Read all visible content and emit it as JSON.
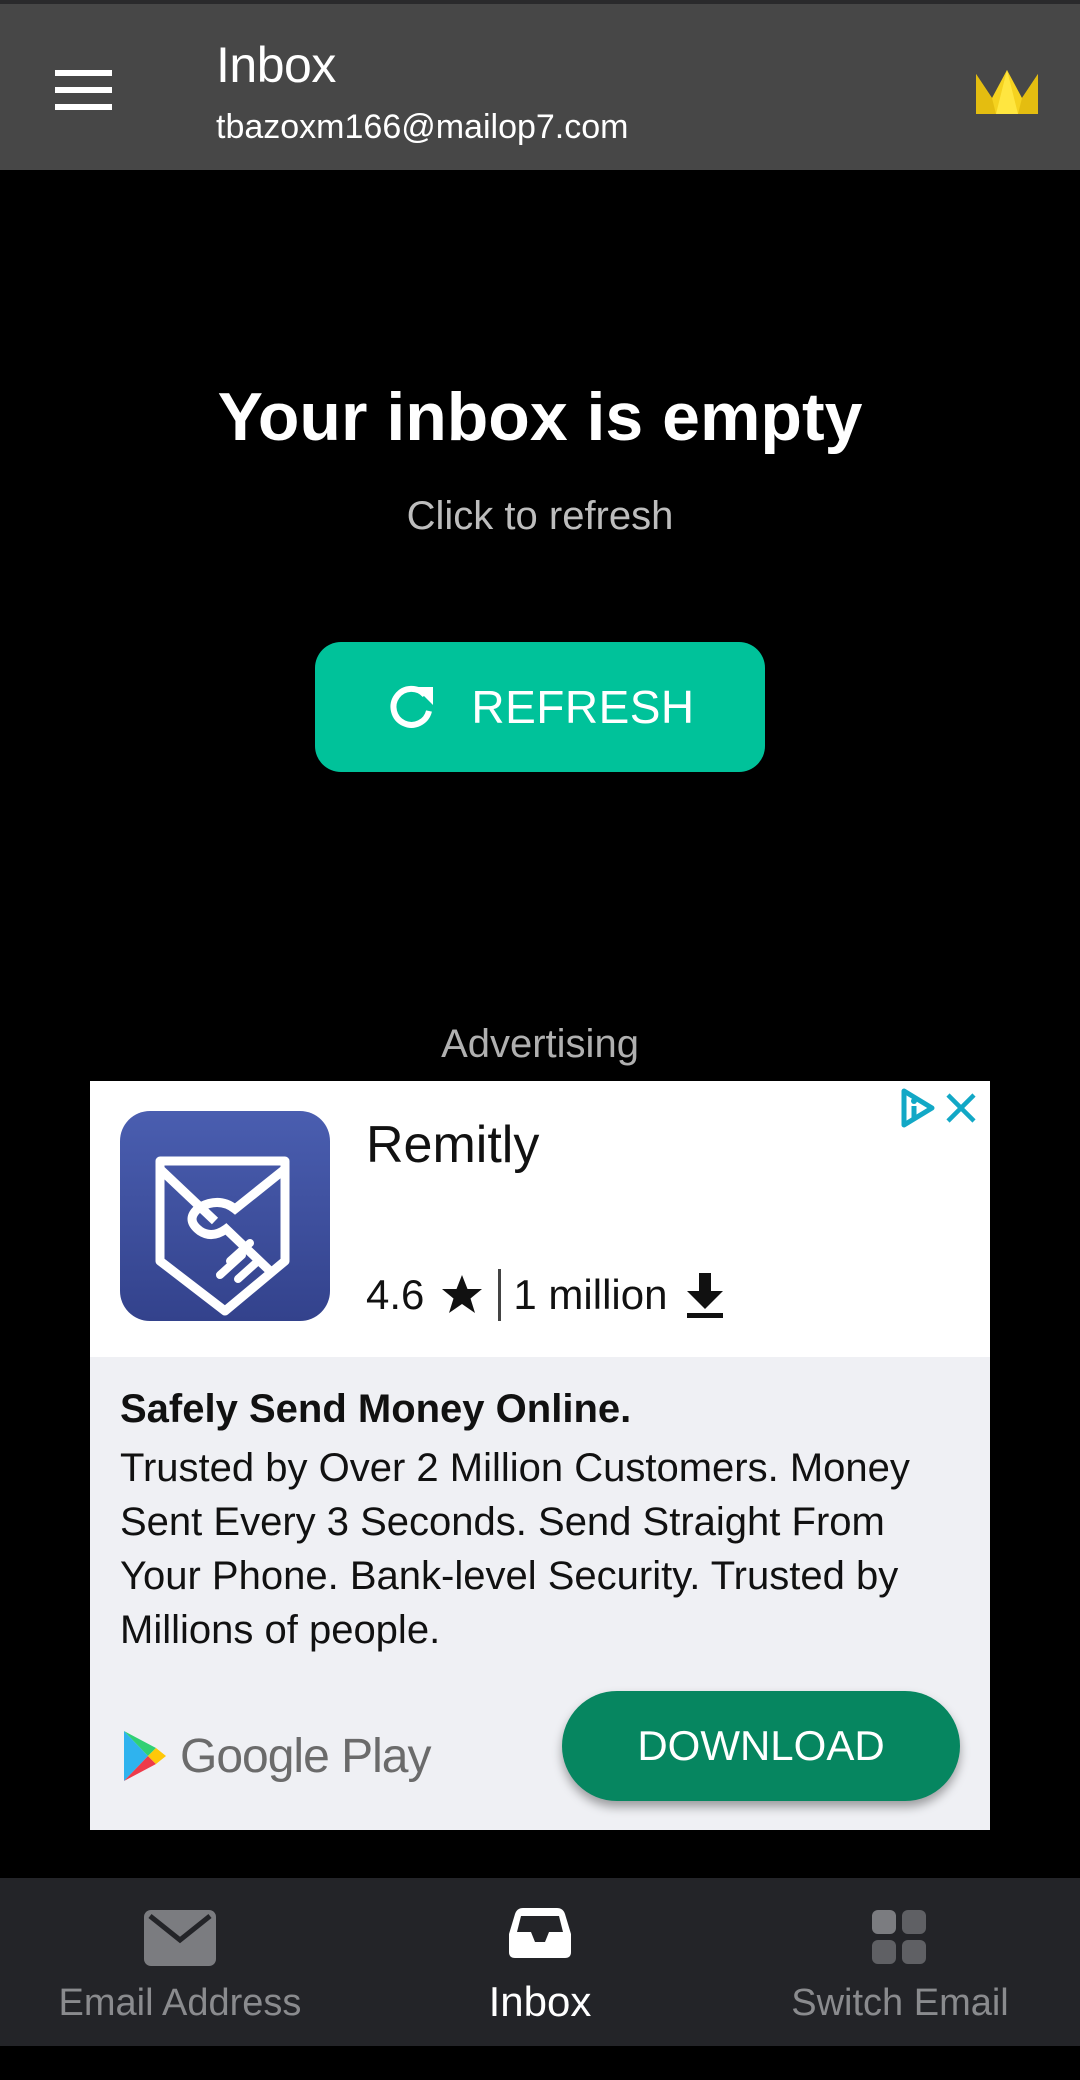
{
  "header": {
    "title": "Inbox",
    "email": "tbazoxm166@mailop7.com",
    "menu_icon": "hamburger-menu-icon",
    "premium_icon": "crown-icon"
  },
  "empty_state": {
    "title": "Your inbox is empty",
    "subtitle": "Click to refresh",
    "refresh_label": "REFRESH",
    "refresh_icon": "refresh-icon"
  },
  "ad": {
    "label": "Advertising",
    "app_name": "Remitly",
    "rating": "4.6",
    "installs": "1 million",
    "headline": "Safely Send Money Online.",
    "body": "Trusted by Over 2 Million Customers. Money Sent Every 3 Seconds. Send Straight From Your Phone. Bank-level Security. Trusted by Millions of people.",
    "store_name": "Google Play",
    "cta": "DOWNLOAD"
  },
  "bottom_nav": {
    "items": [
      {
        "label": "Email Address",
        "icon": "envelope-icon",
        "active": false
      },
      {
        "label": "Inbox",
        "icon": "inbox-tray-icon",
        "active": true
      },
      {
        "label": "Switch Email",
        "icon": "grid-icon",
        "active": false
      }
    ]
  },
  "colors": {
    "appbar": "#474747",
    "accent": "#00c29a",
    "cta": "#068660",
    "nav_bg": "#232428",
    "crown": "#f5d21f"
  }
}
